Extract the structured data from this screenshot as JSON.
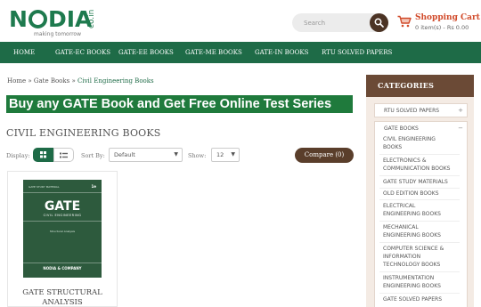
{
  "logo": {
    "brand_pre": "N",
    "brand_post": "DIA",
    "domain": "co.in",
    "tagline": "making tomorrow"
  },
  "search": {
    "placeholder": "Search"
  },
  "cart": {
    "title": "Shopping Cart",
    "summary": "0 item(s) - Rs 0.00"
  },
  "nav": {
    "items": [
      "HOME",
      "GATE-EC BOOKS",
      "GATE-EE BOOKS",
      "GATE-ME BOOKS",
      "GATE-IN BOOKS",
      "RTU SOLVED PAPERS"
    ]
  },
  "breadcrumb": {
    "home": "Home",
    "sep": "»",
    "parent": "Gate Books",
    "current": "Civil Engineering Books"
  },
  "banner": {
    "text": "Buy any GATE Book and Get Free Online Test Series"
  },
  "page": {
    "title": "CIVIL ENGINEERING BOOKS"
  },
  "toolbar": {
    "display_label": "Display:",
    "sort_label": "Sort By:",
    "sort_value": "Default",
    "show_label": "Show:",
    "show_value": "12",
    "compare_label": "Compare (0)"
  },
  "product": {
    "cover_series": "GATE STUDY MATERIAL",
    "cover_edition": "1e",
    "cover_title": "GATE",
    "cover_subtitle": "CIVIL ENGINEERING",
    "cover_topic": "Structural Analysis",
    "cover_publisher": "NODIA & COMPANY",
    "name_line1": "GATE STRUCTURAL",
    "name_line2": "ANALYSIS"
  },
  "sidebar": {
    "heading": "CATEGORIES",
    "groups": [
      {
        "label": "RTU SOLVED PAPERS",
        "toggle": "+"
      },
      {
        "label": "GATE BOOKS",
        "toggle": "−"
      }
    ],
    "subitems": [
      [
        "CIVIL ENGINEERING",
        "BOOKS"
      ],
      [
        "ELECTRONICS &",
        "COMMUNICATION BOOKS"
      ],
      [
        "GATE STUDY MATERIALS"
      ],
      [
        "OLD EDITION BOOKS"
      ],
      [
        "ELECTRICAL",
        "ENGINEERING BOOKS"
      ],
      [
        "MECHANICAL",
        "ENGINEERING BOOKS"
      ],
      [
        "COMPUTER SCIENCE &",
        "INFORMATION",
        "TECHNOLOGY BOOKS"
      ],
      [
        "INSTRUMENTATION",
        "ENGINEERING BOOKS"
      ],
      [
        "GATE SOLVED PAPERS"
      ]
    ]
  },
  "colors": {
    "brand_green": "#1e6b47",
    "sidebar_brown": "#6b4a36",
    "cart_red": "#d14b2b",
    "banner_green": "#1f7a3c"
  }
}
